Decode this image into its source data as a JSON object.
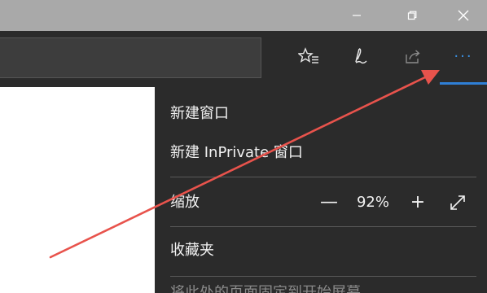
{
  "window_controls": {
    "minimize_icon": "minimize-icon",
    "maximize_icon": "restore-icon",
    "close_icon": "close-icon"
  },
  "toolbar": {
    "icons": [
      "favorites-star-icon",
      "pen-icon",
      "share-icon",
      "more-icon"
    ],
    "more_label": "···",
    "accent": "#2f7fd6"
  },
  "menu": {
    "new_window": "新建窗口",
    "new_inprivate": "新建 InPrivate 窗口",
    "zoom_label": "缩放",
    "zoom_minus": "—",
    "zoom_value": "92%",
    "zoom_plus": "+",
    "favorites": "收藏夹",
    "next_item_partial": "将此处的页面固定到开始屏幕"
  },
  "annotation": {
    "arrow_color": "#e8534c"
  }
}
